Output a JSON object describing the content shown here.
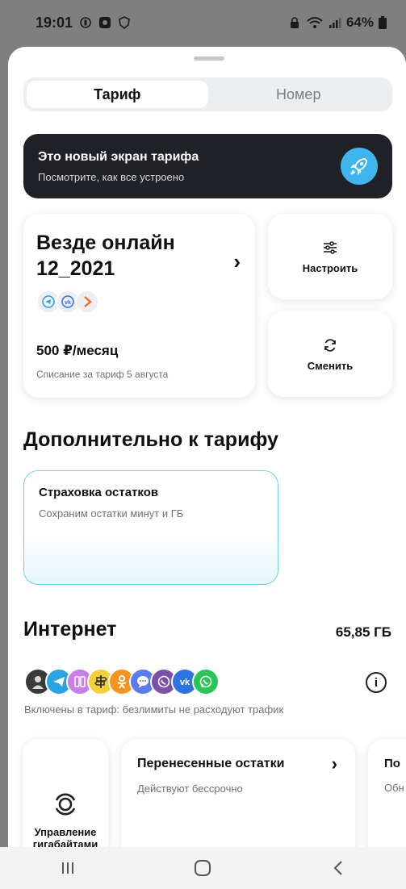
{
  "status_bar": {
    "time": "19:01",
    "battery": "64%",
    "icons": [
      "vibrate-icon",
      "photo-icon",
      "shield-icon",
      "lock-icon",
      "wifi-icon",
      "signal-icon",
      "battery-icon"
    ]
  },
  "tabs": [
    {
      "label": "Тариф",
      "active": true
    },
    {
      "label": "Номер",
      "active": false
    }
  ],
  "banner": {
    "title": "Это новый экран тарифа",
    "subtitle": "Посмотрите, как все устроено",
    "icon": "rocket-icon",
    "accent": "#3fb4ee"
  },
  "tariff": {
    "name": "Везде онлайн 12_2021",
    "apps": [
      "telegram-icon",
      "vk-icon",
      "chevron-app-icon"
    ],
    "price": "500 ₽/месяц",
    "charge_note": "Списание за тариф 5 августа"
  },
  "actions": [
    {
      "label": "Настроить",
      "icon": "sliders-icon"
    },
    {
      "label": "Сменить",
      "icon": "refresh-icon"
    }
  ],
  "extra": {
    "heading": "Дополнительно к тарифу",
    "insurance_title": "Страховка остатков",
    "insurance_subtitle": "Сохраним остатки минут и ГБ"
  },
  "internet": {
    "heading": "Интернет",
    "amount": "65,85 ГБ",
    "apps": [
      {
        "icon": "avatar-icon",
        "color": "#3a3a3a"
      },
      {
        "icon": "telegram-icon",
        "color": "#2aa3e0"
      },
      {
        "icon": "app-grid-icon",
        "color": "#c77ee6"
      },
      {
        "icon": "signpost-icon",
        "color": "#f2d23c"
      },
      {
        "icon": "ok-icon",
        "color": "#f7931e"
      },
      {
        "icon": "messenger-icon",
        "color": "#5a7cf0"
      },
      {
        "icon": "viber-icon",
        "color": "#7b50a8"
      },
      {
        "icon": "vk-icon",
        "color": "#2f73e0"
      },
      {
        "icon": "whatsapp-icon",
        "color": "#2bc557"
      }
    ],
    "included_note": "Включены в тариф: безлимиты не расходуют трафик",
    "manage_label": "Управление гигабайтами",
    "carry_title": "Перенесенные остатки",
    "carry_subtitle": "Действуют бессрочно",
    "peek_title": "По",
    "peek_subtitle": "Обн"
  }
}
